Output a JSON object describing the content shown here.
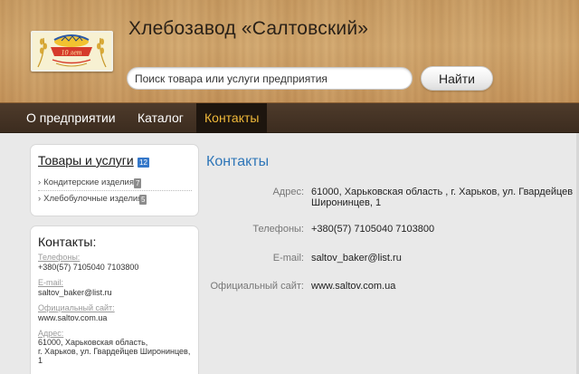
{
  "header": {
    "title": "Хлебозавод «Салтовский»",
    "logo": {
      "text": "10 лет"
    }
  },
  "search": {
    "placeholder": "Поиск товара или услуги предприятия",
    "button_label": "Найти"
  },
  "nav": {
    "items": [
      {
        "label": "О предприятии",
        "active": false
      },
      {
        "label": "Каталог",
        "active": false
      },
      {
        "label": "Контакты",
        "active": true
      }
    ]
  },
  "sidebar": {
    "goods": {
      "title": "Товары и услуги",
      "count": "12",
      "items": [
        {
          "label": "Кондитерские изделия",
          "count": "7"
        },
        {
          "label": "Хлебобулочные изделия",
          "count": "5"
        }
      ]
    },
    "contacts": {
      "title": "Контакты:",
      "phone_label": "Телефоны:",
      "phone_value": "+380(57) 7105040 7103800",
      "email_label": "E-mail:",
      "email_value": "saltov_baker@list.ru",
      "site_label": "Официальный сайт:",
      "site_value": "www.saltov.com.ua",
      "address_label": "Адрес:",
      "address_line1": "61000, Харьковская область,",
      "address_line2": "г. Харьков, ул. Гвардейцев Широнинцев,",
      "address_line3": "1"
    }
  },
  "main": {
    "heading": "Контакты",
    "rows": [
      {
        "label": "Адрес:",
        "value_line1": "61000, Харьковская область , г. Харьков, ул. Гвардейцев",
        "value_line2": "Широнинцев, 1"
      },
      {
        "label": "Телефоны:",
        "value": "+380(57) 7105040 7103800"
      },
      {
        "label": "E-mail:",
        "value": "saltov_baker@list.ru"
      },
      {
        "label": "Официальный сайт:",
        "value": "www.saltov.com.ua"
      }
    ]
  },
  "colors": {
    "accent_link": "#2f76b8",
    "nav_active_text": "#f0b93a",
    "nav_background": "#3c2c1f",
    "badge_blue": "#3477c9"
  }
}
